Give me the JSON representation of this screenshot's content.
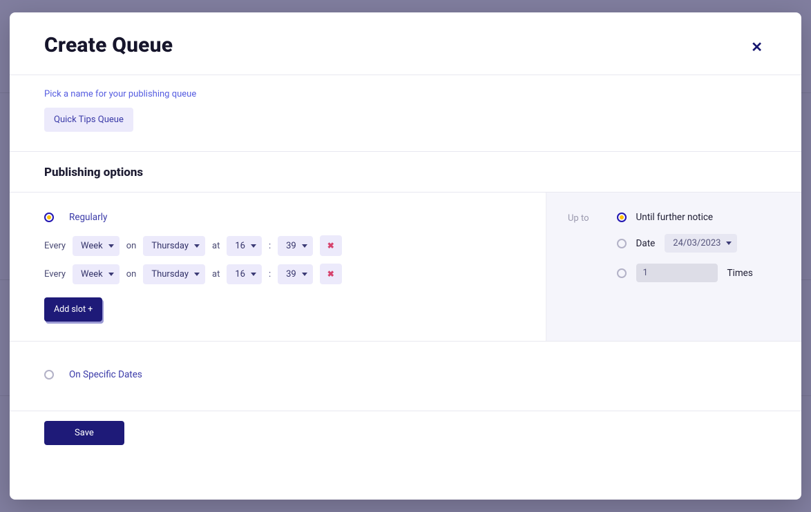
{
  "header": {
    "title": "Create Queue"
  },
  "name_section": {
    "caption": "Pick a name for your publishing queue",
    "value": "Quick Tips Queue"
  },
  "publishing": {
    "heading": "Publishing options",
    "regularly_label": "Regularly",
    "every_label": "Every",
    "on_label": "on",
    "at_label": "at",
    "slots": [
      {
        "period": "Week",
        "day": "Thursday",
        "hour": "16",
        "minute": "39"
      },
      {
        "period": "Week",
        "day": "Thursday",
        "hour": "16",
        "minute": "39"
      }
    ],
    "add_slot_label": "Add slot +",
    "specific_label": "On Specific Dates"
  },
  "upto": {
    "label": "Up to",
    "until_further": "Until further notice",
    "date_label": "Date",
    "date_value": "24/03/2023",
    "times_value": "1",
    "times_label": "Times"
  },
  "footer": {
    "save": "Save"
  }
}
